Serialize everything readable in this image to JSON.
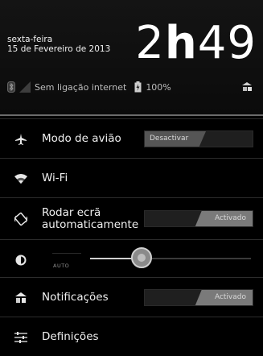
{
  "header": {
    "date_line1": "sexta-feira",
    "date_line2": "15 de Fevereiro de 2013",
    "time_hour": "2",
    "time_h": "h",
    "time_minutes": "49"
  },
  "status": {
    "network": "Sem ligação internet",
    "battery": "100%"
  },
  "settings": {
    "airplane": {
      "label": "Modo de avião",
      "toggle": "Desactivar"
    },
    "wifi": {
      "label": "Wi-Fi"
    },
    "rotate": {
      "label_line1": "Rodar ecrã",
      "label_line2": "automaticamente",
      "toggle": "Activado"
    },
    "brightness": {
      "auto_label": "AUTO",
      "level_fraction": 0.32
    },
    "notifications": {
      "label": "Notificações",
      "toggle": "Activado"
    },
    "settings": {
      "label": "Definições"
    }
  },
  "icons": {
    "bluetooth": "bluetooth-icon",
    "signal": "signal-icon",
    "battery": "battery-icon",
    "sync": "sync-icon",
    "airplane": "airplane-icon",
    "wifi": "wifi-icon",
    "rotate": "rotate-icon",
    "brightness": "brightness-icon",
    "notifications": "notifications-icon",
    "settings": "settings-icon"
  }
}
